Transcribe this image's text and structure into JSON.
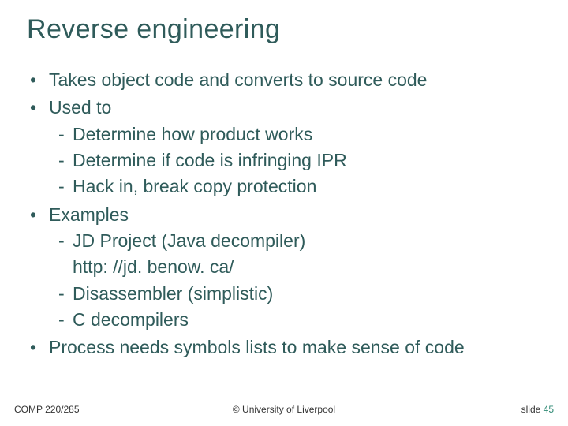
{
  "title": "Reverse engineering",
  "bullets": {
    "b1": "Takes object code and converts to source code",
    "b2": "Used to",
    "b2_sub": {
      "s1": "Determine how product works",
      "s2": "Determine if code is infringing IPR",
      "s3": "Hack in, break copy protection"
    },
    "b3": "Examples",
    "b3_sub": {
      "s1": "JD Project (Java decompiler)",
      "s1_extra": "http: //jd. benow. ca/",
      "s2": "Disassembler (simplistic)",
      "s3": "C decompilers"
    },
    "b4": "Process needs symbols lists to make sense of code"
  },
  "footer": {
    "left": "COMP 220/285",
    "center": "© University of Liverpool",
    "right_label": "slide",
    "right_num": "45"
  }
}
